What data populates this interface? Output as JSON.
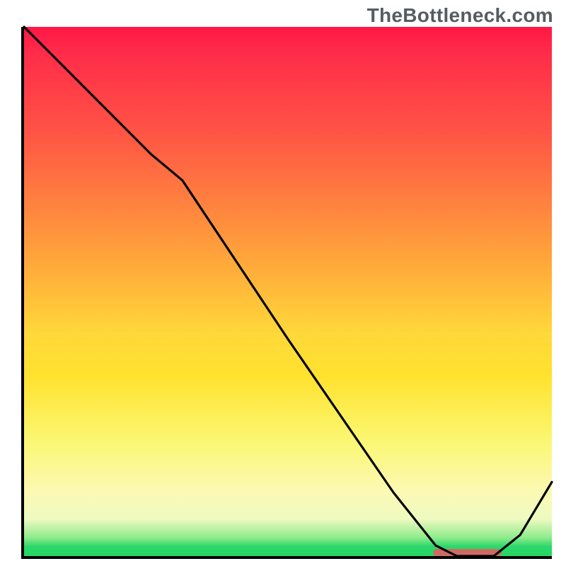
{
  "watermark": "TheBottleneck.com",
  "colors": {
    "gradient_top": "#ff1846",
    "gradient_mid_orange": "#ffa745",
    "gradient_yellow": "#fff93f",
    "gradient_green": "#24d766",
    "indicator": "#cf6a63",
    "curve": "#000000",
    "axis": "#000000"
  },
  "chart_data": {
    "type": "line",
    "title": "",
    "xlabel": "",
    "ylabel": "",
    "xlim": [
      0,
      1
    ],
    "ylim": [
      0,
      1
    ],
    "series": [
      {
        "name": "bottleneck-curve",
        "x": [
          0.0,
          0.12,
          0.24,
          0.3,
          0.5,
          0.7,
          0.78,
          0.82,
          0.89,
          0.94,
          1.0
        ],
        "y": [
          1.0,
          0.88,
          0.76,
          0.71,
          0.41,
          0.12,
          0.02,
          0.0,
          0.0,
          0.04,
          0.14
        ]
      }
    ],
    "optimal_band": {
      "x_start": 0.77,
      "x_end": 0.9,
      "y": 0.988
    }
  }
}
